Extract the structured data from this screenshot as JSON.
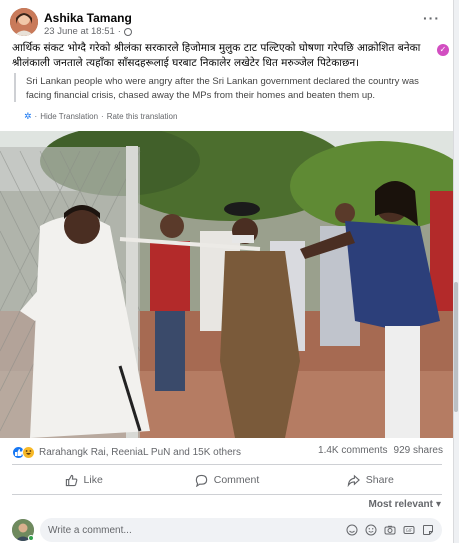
{
  "post": {
    "author": "Ashika Tamang",
    "timestamp": "23 June at 18:51",
    "separator": "·",
    "more_label": "···",
    "original_text": "आर्थिक संकट भोग्दै गरेको श्रीलंका सरकारले हिजोमात्र मुलुक टाट पल्टिएको घोषणा गरेपछि आक्रोशित बनेका श्रीलंकाली जनताले त्यहाँका साँसदहरूलाई घरबाट निकालेर लखेटेर धित मरुञ्जेल पिटेकाछन।",
    "verified_mark": "✓",
    "translation_text": "Sri Lankan people who were angry after the Sri Lankan government declared the country was facing financial crisis, chased away the MPs from their homes and beaten them up.",
    "hide_translation": "Hide Translation",
    "link_separator": "·",
    "rate_translation": "Rate this translation"
  },
  "engagement": {
    "reactors": "Rarahangk Rai, ReeniaL PuN and 15K others",
    "comments": "1.4K comments",
    "shares": "929 shares"
  },
  "actions": {
    "like": "Like",
    "comment": "Comment",
    "share": "Share"
  },
  "comments": {
    "sort_label": "Most relevant",
    "placeholder": "Write a comment..."
  },
  "colors": {
    "accent": "#1877f2",
    "verified": "#d24ec1",
    "muted_text": "#65676b"
  }
}
